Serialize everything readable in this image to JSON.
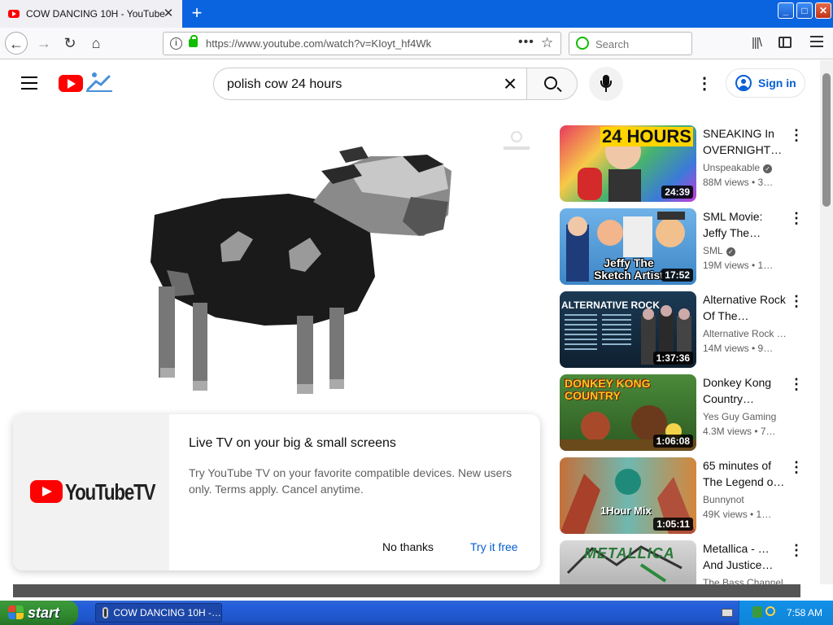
{
  "browser": {
    "tab_title": "COW DANCING 10H - YouTube",
    "url": "https://www.youtube.com/watch?v=KIoyt_hf4Wk",
    "search_placeholder": "Search",
    "new_tab_symbol": "+",
    "window_buttons": {
      "minimize": "_",
      "maximize": "□",
      "close": "✕"
    }
  },
  "youtube": {
    "search_query": "polish cow 24 hours",
    "sign_in_label": "Sign in",
    "promo": {
      "title": "Live TV on your big & small screens",
      "body": "Try YouTube TV on your favorite compatible devices. New users only. Terms apply. Cancel anytime.",
      "logo_text": "YouTubeTV",
      "dismiss_label": "No thanks",
      "confirm_label": "Try it free"
    },
    "recommendations": [
      {
        "title": "SNEAKING In OVERNIGHT…",
        "channel": "Unspeakable",
        "verified": true,
        "meta": "88M views • 3…",
        "duration": "24:39",
        "thumb_text": "24 HOURS"
      },
      {
        "title": "SML Movie: Jeffy The…",
        "channel": "SML",
        "verified": true,
        "meta": "19M views • 1…",
        "duration": "17:52",
        "thumb_text": "Jeffy The Sketch Artist"
      },
      {
        "title": "Alternative Rock Of The…",
        "channel": "Alternative Rock …",
        "verified": false,
        "meta": "14M views • 9…",
        "duration": "1:37:36",
        "thumb_text": "ALTERNATIVE ROCK"
      },
      {
        "title": "Donkey Kong Country…",
        "channel": "Yes Guy Gaming",
        "verified": false,
        "meta": "4.3M views • 7…",
        "duration": "1:06:08",
        "thumb_text": "DONKEY KONG COUNTRY"
      },
      {
        "title": "65 minutes of The Legend o…",
        "channel": "Bunnynot",
        "verified": false,
        "meta": "49K views • 1…",
        "duration": "1:05:11",
        "thumb_text": "1Hour Mix"
      },
      {
        "title": "Metallica - …And Justice…",
        "channel": "The Bass Channel",
        "verified": false,
        "meta": "",
        "duration": "",
        "thumb_text": "METALLICA"
      }
    ]
  },
  "taskbar": {
    "start_label": "start",
    "task_label": "COW DANCING 10H -…",
    "clock": "7:58 AM"
  },
  "colors": {
    "youtube_red": "#ff0000",
    "link_blue": "#065fd4",
    "xp_blue": "#245edb",
    "xp_green": "#3c9a3c"
  },
  "icons": [
    "back-arrow-icon",
    "forward-arrow-icon",
    "reload-icon",
    "home-icon",
    "info-icon",
    "lock-icon",
    "page-actions-icon",
    "bookmark-star-icon",
    "library-icon",
    "sidebar-icon",
    "hamburger-icon",
    "search-icon",
    "clear-icon",
    "mic-icon",
    "more-vert-icon",
    "account-icon",
    "verified-icon",
    "windows-flag-icon",
    "clock-icon"
  ]
}
